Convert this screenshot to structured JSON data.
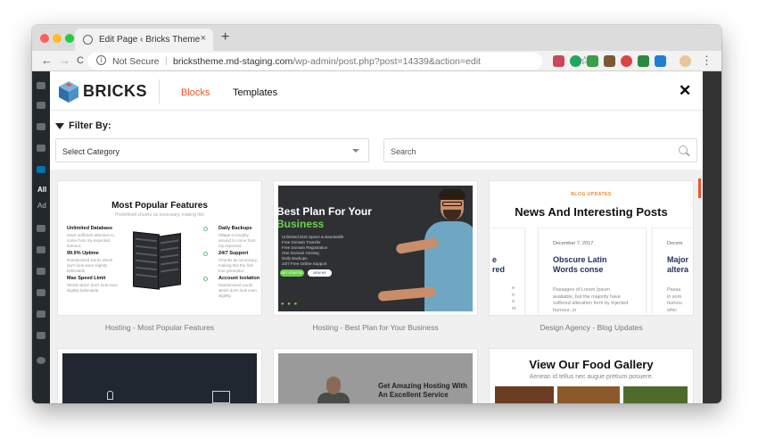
{
  "window": {
    "tab_title": "Edit Page ‹ Bricks Theme — W",
    "tab_close": "×",
    "new_tab": "+",
    "colors": {
      "close": "#ff5f57",
      "minimize": "#febc2e",
      "maximize": "#28c840"
    }
  },
  "toolbar": {
    "back": "←",
    "forward": "→",
    "reload": "C",
    "not_secure": "Not Secure",
    "url_host": "brickstheme.md-staging.com",
    "url_path": "/wp-admin/post.php?post=14339&action=edit",
    "star": "☆",
    "menu": "⋮"
  },
  "wp_admin": {
    "items": [
      "All",
      "Ad"
    ]
  },
  "app": {
    "logo": "BRICKS",
    "tabs": [
      {
        "label": "Blocks",
        "active": true
      },
      {
        "label": "Templates",
        "active": false
      }
    ],
    "close": "✕",
    "accent": "#e8562a"
  },
  "filter": {
    "label": "Filter By:",
    "category_value": "Select Category",
    "search_placeholder": "Search"
  },
  "cards": [
    {
      "caption": "Hosting - Most Popular Features",
      "preview": {
        "title": "Most Popular Features",
        "subtitle": "Predefined chunks as necessary, making this",
        "features_left": [
          {
            "title": "Unlimited Database",
            "desc": "Have sufficient attention to come from my expected humour."
          },
          {
            "title": "99.9% Uptime",
            "desc": "Randomised words which don't look even slightly believable."
          },
          {
            "title": "Max Speed Limit",
            "desc": "Words which don't look even slightly believable."
          }
        ],
        "features_right": [
          {
            "title": "Daily Backups",
            "desc": "Oltage in lengthy around to come from my expected."
          },
          {
            "title": "24/7 Support",
            "desc": "Chunks as necessary, making this the first true generator."
          },
          {
            "title": "Account Isolation",
            "desc": "Randomised words which don't look even slightly."
          }
        ]
      }
    },
    {
      "caption": "Hosting - Best Plan for Your Business",
      "preview": {
        "title_line1": "Best Plan For Your",
        "title_line2": "Business",
        "list": [
          "Unlimited Disk Space & Bandwidth",
          "Free Domain Transfer",
          "Free Domain Registration",
          "One Domain Hosting",
          "Daily Backups",
          "24/7 Free Online Support"
        ],
        "button1": "GET STARTED",
        "button2": "VIEW MY PLANS",
        "dots": "● ● ●"
      }
    },
    {
      "caption": "Design Agency - Blog Updates",
      "preview": {
        "tag": "BLOG UPDATES",
        "title": "News And Interesting Posts",
        "posts": [
          {
            "date": "",
            "title": "e\nred",
            "excerpt": "e\nn\no\nor"
          },
          {
            "date": "December 7, 2017",
            "title": "Obscure Latin Words conse",
            "excerpt": "Passages of Lorem Ipsum available, but the majority have suffered alteration form by injected humour, or"
          },
          {
            "date": "Decem",
            "title": "Major\naltera",
            "excerpt": "Passa\nin som\nhumou\nwhic"
          }
        ]
      }
    },
    {
      "caption": "",
      "preview": {}
    },
    {
      "caption": "",
      "preview": {
        "title": "Get Amazing Hosting With An Excellent Service"
      }
    },
    {
      "caption": "",
      "preview": {
        "title": "View Our Food Gallery",
        "subtitle": "Aenean id tellus nec augue pretium posuere."
      }
    }
  ]
}
